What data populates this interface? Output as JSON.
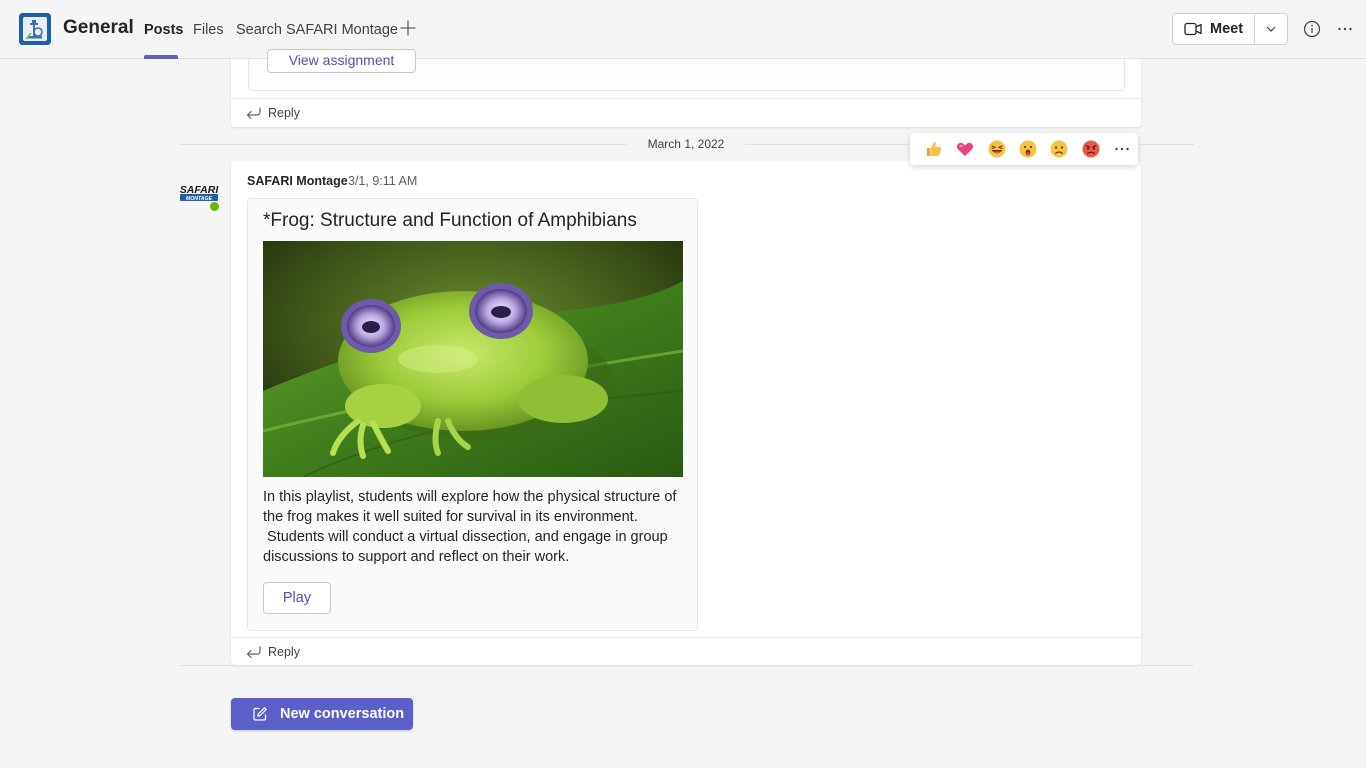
{
  "header": {
    "channel_name": "General",
    "team_logo_icon": "microscope-icon",
    "tabs": [
      {
        "label": "Posts",
        "active": true
      },
      {
        "label": "Files",
        "active": false
      },
      {
        "label": "Search SAFARI Montage",
        "active": false
      }
    ],
    "add_tab_icon": "plus-icon",
    "meet_label": "Meet",
    "meet_icon": "video-camera-icon",
    "meet_dropdown_icon": "chevron-down-icon",
    "info_icon": "info-icon",
    "more_icon": "more-horizontal-icon"
  },
  "previous_post": {
    "button_label": "View assignment",
    "reply_label": "Reply"
  },
  "date_divider": "March 1, 2022",
  "post": {
    "author": "SAFARI Montage",
    "timestamp": "3/1, 9:11 AM",
    "avatar_text": "SAFARI",
    "avatar_subtext": "MONTAGE",
    "card": {
      "title": "*Frog: Structure and Function of Amphibians",
      "image_icon": "frog-photo",
      "description_lines": [
        "In this playlist, students will explore how the physical structure of",
        "the frog makes it well suited for survival in its environment.",
        " Students will conduct a virtual dissection, and engage in group",
        "discussions to support and reflect on their work."
      ],
      "play_label": "Play"
    },
    "reply_label": "Reply"
  },
  "reactions": [
    "like-icon",
    "heart-icon",
    "laugh-icon",
    "surprised-icon",
    "sad-icon",
    "angry-icon"
  ],
  "reactions_more_icon": "more-horizontal-icon",
  "new_conversation_label": "New conversation",
  "new_conversation_icon": "compose-icon",
  "colors": {
    "accent": "#5b5fc7",
    "link": "#4f52b2",
    "background": "#f5f5f5",
    "card": "#ffffff",
    "presence_available": "#6bb700"
  }
}
